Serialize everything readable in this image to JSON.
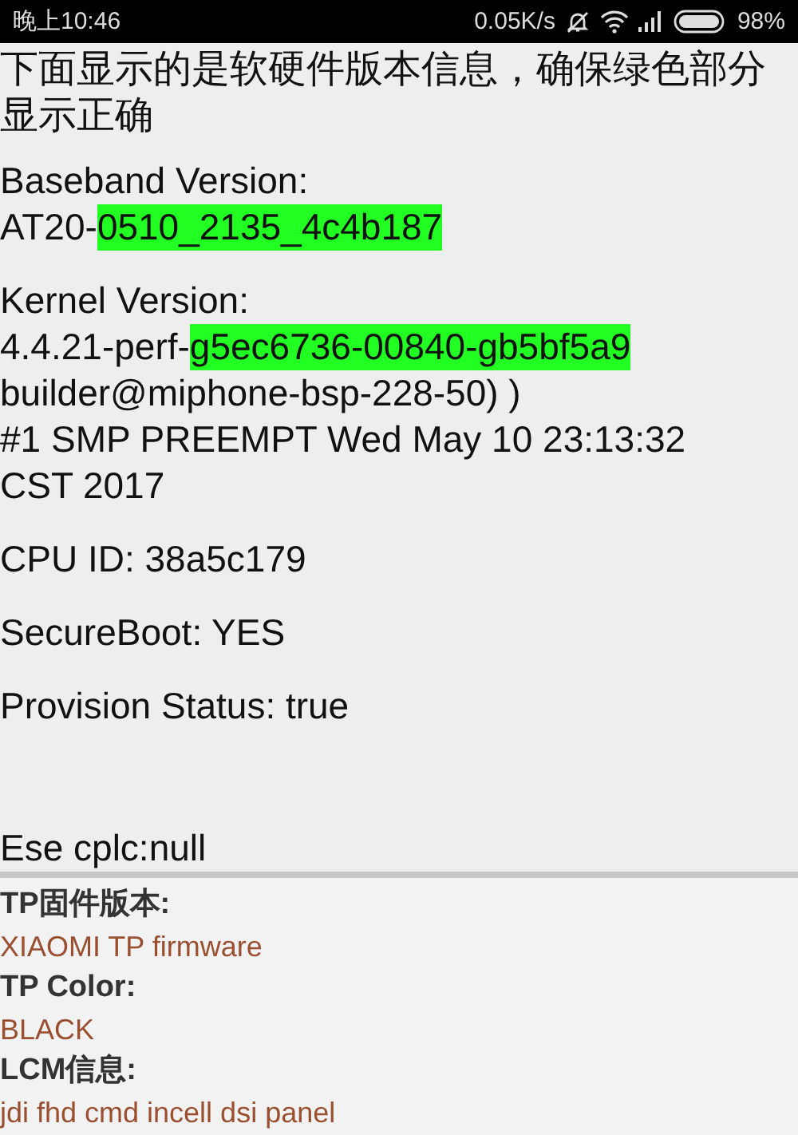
{
  "status_bar": {
    "time": "晚上10:46",
    "speed": "0.05K/s",
    "battery": "98%"
  },
  "header": {
    "text": "下面显示的是软硬件版本信息，确保绿色部分显示正确"
  },
  "info_blocks": [
    {
      "lines": [
        [
          {
            "text": "Baseband Version:",
            "highlight": false
          }
        ],
        [
          {
            "text": "AT20-",
            "highlight": false
          },
          {
            "text": "0510_2135_4c4b187",
            "highlight": true
          }
        ]
      ]
    },
    {
      "lines": [
        [
          {
            "text": "Kernel Version:",
            "highlight": false
          }
        ],
        [
          {
            "text": "4.4.21-perf-",
            "highlight": false
          },
          {
            "text": "g5ec6736-00840-gb5bf5a9",
            "highlight": true
          }
        ],
        [
          {
            "text": "builder@miphone-bsp-228-50) )",
            "highlight": false
          }
        ],
        [
          {
            "text": "#1 SMP PREEMPT Wed May 10 23:13:32",
            "highlight": false
          }
        ],
        [
          {
            "text": "CST 2017",
            "highlight": false
          }
        ]
      ]
    },
    {
      "lines": [
        [
          {
            "text": "CPU ID: 38a5c179",
            "highlight": false
          }
        ]
      ]
    },
    {
      "lines": [
        [
          {
            "text": "SecureBoot: YES",
            "highlight": false
          }
        ]
      ]
    },
    {
      "lines": [
        [
          {
            "text": "Provision Status: true",
            "highlight": false
          }
        ]
      ]
    },
    {
      "lines": [
        [
          {
            "text": "Ese cplc:null",
            "highlight": false
          }
        ]
      ]
    }
  ],
  "details": [
    {
      "label": "TP固件版本:",
      "value": "XIAOMI TP firmware"
    },
    {
      "label": "TP Color:",
      "value": "BLACK"
    },
    {
      "label": "LCM信息:",
      "value": "jdi fhd cmd incell dsi panel"
    }
  ]
}
